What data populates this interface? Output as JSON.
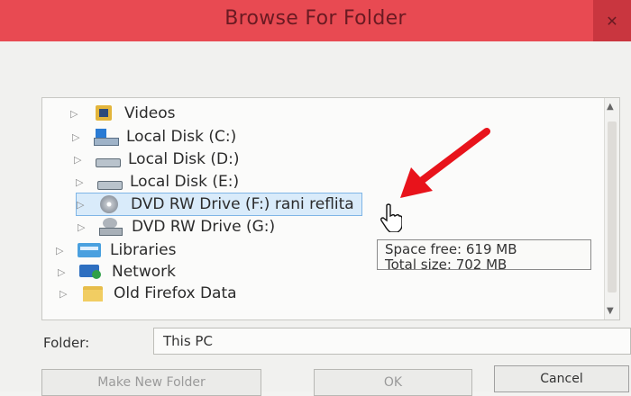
{
  "window": {
    "title": "Browse For Folder",
    "close_glyph": "✕"
  },
  "tree": {
    "items": [
      {
        "label": "Videos",
        "icon": "videos-icon"
      },
      {
        "label": "Local Disk (C:)",
        "icon": "local-disk-c-icon"
      },
      {
        "label": "Local Disk (D:)",
        "icon": "local-disk-icon"
      },
      {
        "label": "Local Disk (E:)",
        "icon": "local-disk-icon"
      },
      {
        "label": "DVD RW Drive (F:) rani reflita",
        "icon": "dvd-drive-icon",
        "selected": true
      },
      {
        "label": "DVD RW Drive (G:)",
        "icon": "dvd-drive-icon"
      },
      {
        "label": "Libraries",
        "icon": "libraries-icon"
      },
      {
        "label": "Network",
        "icon": "network-icon"
      },
      {
        "label": "Old Firefox Data",
        "icon": "folder-icon"
      }
    ],
    "expander_glyph": "▷"
  },
  "tooltip": {
    "line1": "Space free: 619 MB",
    "line2": "Total size: 702 MB"
  },
  "folder": {
    "label": "Folder:",
    "value": "This PC"
  },
  "buttons": {
    "make_new_folder": "Make New Folder",
    "ok": "OK",
    "cancel": "Cancel"
  },
  "colors": {
    "titlebar": "#e84a52",
    "selection": "#d9ebfa",
    "annotation_arrow": "#e8131b"
  }
}
